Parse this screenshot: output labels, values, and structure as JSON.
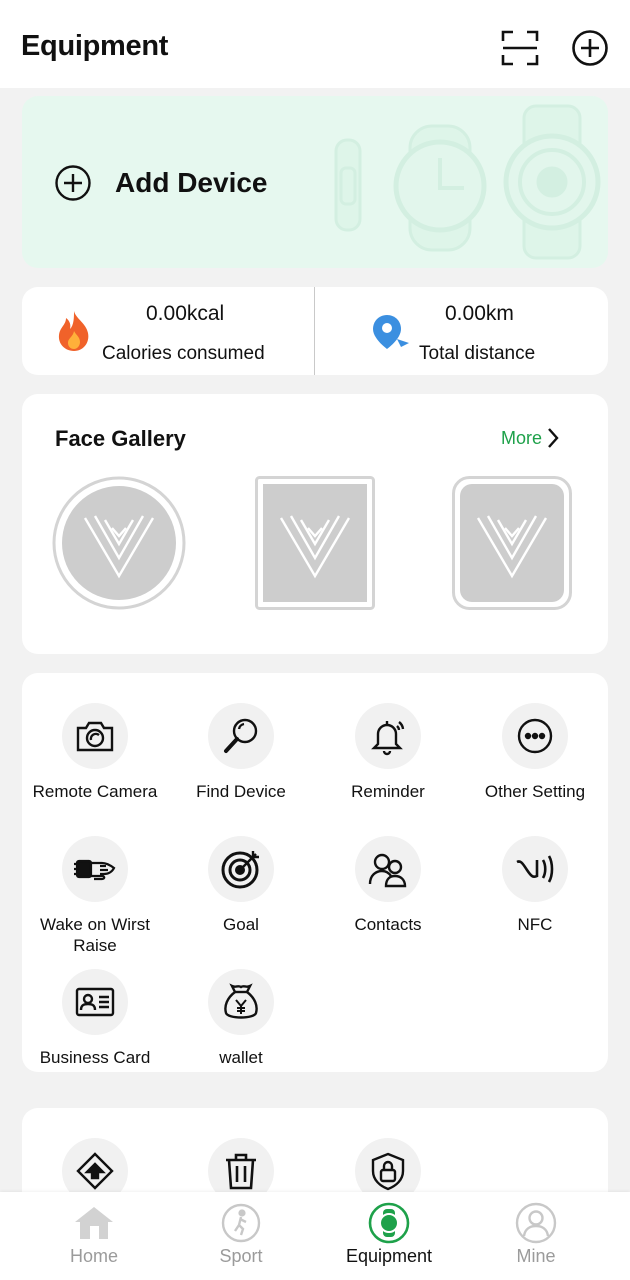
{
  "header": {
    "title": "Equipment",
    "scan_icon": "scan-icon",
    "add_icon": "plus-circle-icon"
  },
  "add_device": {
    "label": "Add Device"
  },
  "stats": {
    "calories": {
      "value": "0.00kcal",
      "label": "Calories consumed",
      "icon": "flame-icon"
    },
    "distance": {
      "value": "0.00km",
      "label": "Total distance",
      "icon": "location-pin-icon"
    }
  },
  "face_gallery": {
    "title": "Face Gallery",
    "more": "More"
  },
  "functions": [
    {
      "label": "Remote Camera",
      "icon": "camera-icon"
    },
    {
      "label": "Find Device",
      "icon": "magnifier-icon"
    },
    {
      "label": "Reminder",
      "icon": "bell-icon"
    },
    {
      "label": "Other Setting",
      "icon": "more-dots-icon"
    },
    {
      "label": "Wake on Wirst Raise",
      "icon": "wrist-raise-icon"
    },
    {
      "label": "Goal",
      "icon": "target-icon"
    },
    {
      "label": "Contacts",
      "icon": "contacts-icon"
    },
    {
      "label": "NFC",
      "icon": "nfc-icon"
    },
    {
      "label": "Business Card",
      "icon": "id-card-icon"
    },
    {
      "label": "wallet",
      "icon": "wallet-icon"
    }
  ],
  "more_functions": [
    {
      "icon": "firmware-upgrade-icon"
    },
    {
      "icon": "trash-icon"
    },
    {
      "icon": "lock-shield-icon"
    }
  ],
  "tabs": [
    {
      "label": "Home",
      "icon": "home-icon",
      "active": false
    },
    {
      "label": "Sport",
      "icon": "sport-icon",
      "active": false
    },
    {
      "label": "Equipment",
      "icon": "watch-icon",
      "active": true
    },
    {
      "label": "Mine",
      "icon": "user-icon",
      "active": false
    }
  ],
  "colors": {
    "accent": "#1ea14a",
    "card_mint": "#e6f8ef",
    "flame": "#f0622a",
    "pin": "#3b8fe0"
  }
}
